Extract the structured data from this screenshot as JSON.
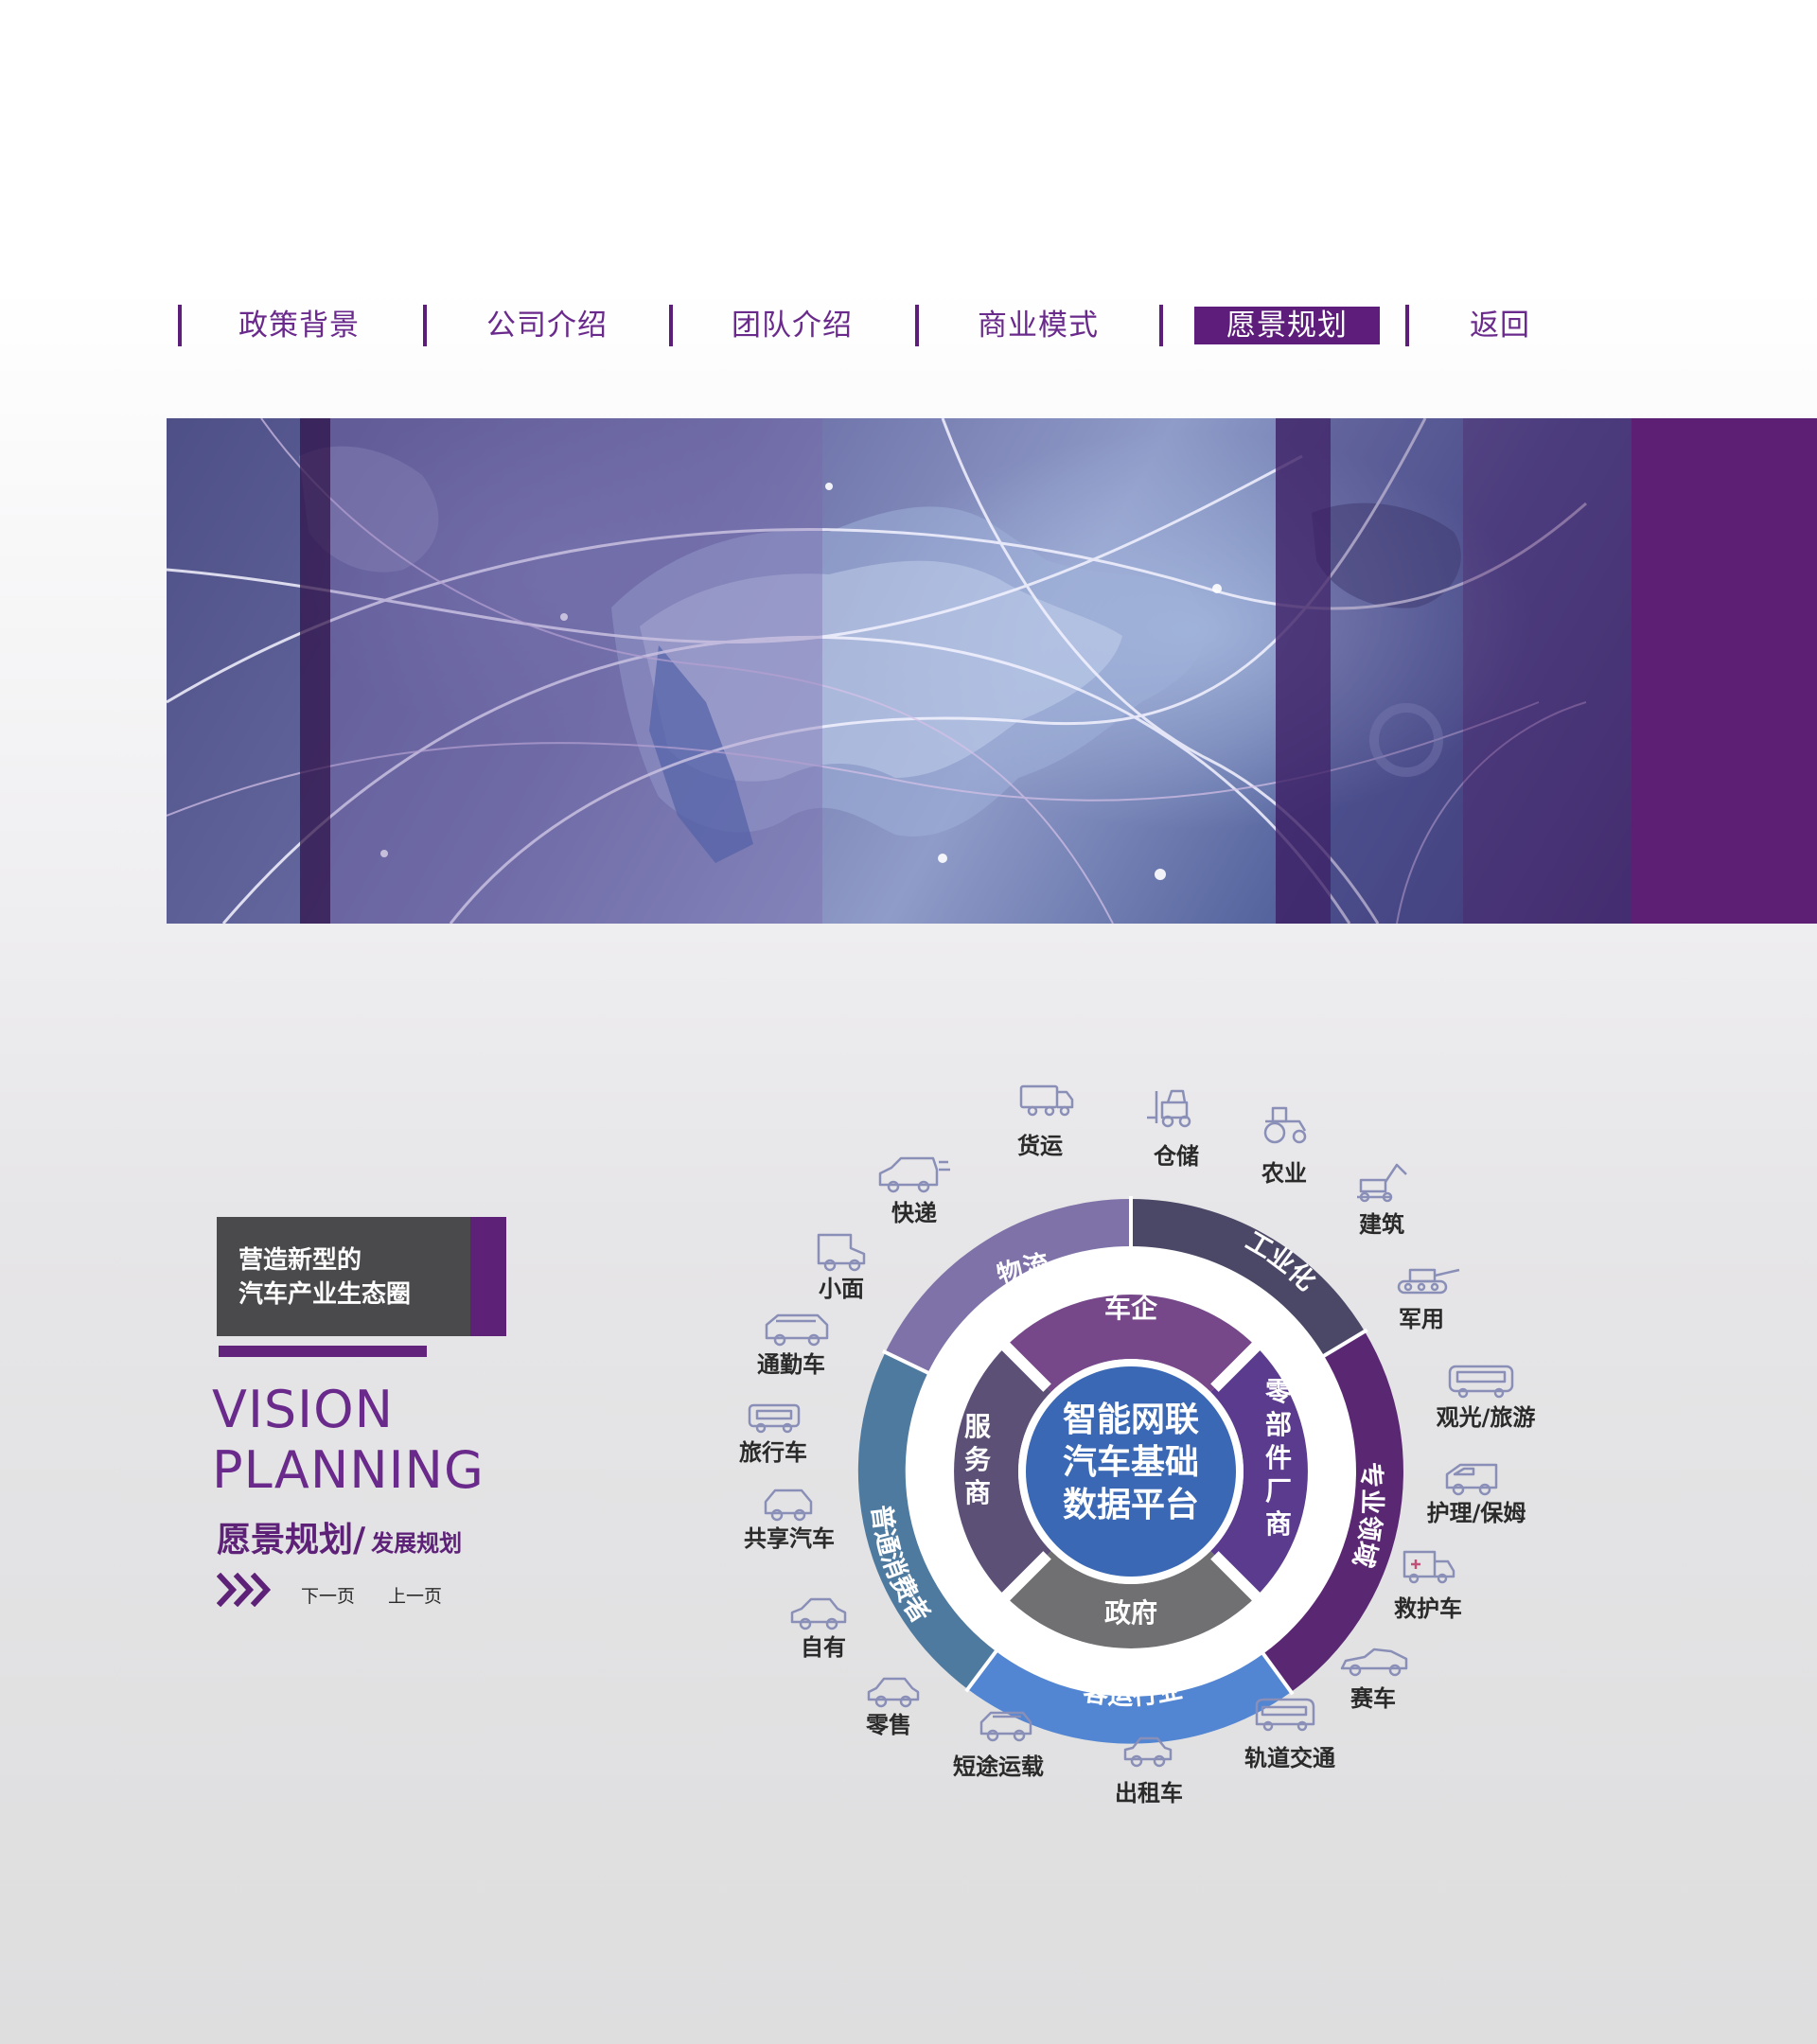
{
  "nav": {
    "items": [
      {
        "label": "政策背景",
        "active": false
      },
      {
        "label": "公司介绍",
        "active": false
      },
      {
        "label": "团队介绍",
        "active": false
      },
      {
        "label": "商业模式",
        "active": false
      },
      {
        "label": "愿景规划",
        "active": true
      },
      {
        "label": "返回",
        "active": false
      }
    ],
    "colors": {
      "accent": "#5e1d7a",
      "text": "#6a2a8c"
    }
  },
  "card": {
    "line1": "营造新型的",
    "line2": "汽车产业生态圈"
  },
  "vision": {
    "title_line1": "VISION",
    "title_line2": "PLANNING",
    "cn_title": "愿景规划/",
    "cn_subtitle": "发展规划"
  },
  "pager": {
    "next_label": "下一页",
    "prev_label": "上一页"
  },
  "ecosystem": {
    "center": [
      "智能网联",
      "汽车基础",
      "数据平台"
    ],
    "inner_ring": {
      "top": "车企",
      "right": [
        "零",
        "部",
        "件",
        "厂",
        "商"
      ],
      "bottom": "政府",
      "left": [
        "服",
        "务",
        "商"
      ]
    },
    "outer_ring": {
      "top_left": "物流",
      "top_right": "工业化",
      "right": "专业领域",
      "bottom": "客运行业",
      "left": "普通消费者"
    },
    "vehicles": [
      {
        "label": "货运",
        "icon": "cargo-truck-icon"
      },
      {
        "label": "仓储",
        "icon": "forklift-icon"
      },
      {
        "label": "农业",
        "icon": "tractor-icon"
      },
      {
        "label": "建筑",
        "icon": "excavator-icon"
      },
      {
        "label": "军用",
        "icon": "tank-icon"
      },
      {
        "label": "观光/旅游",
        "icon": "tour-bus-icon"
      },
      {
        "label": "护理/保姆",
        "icon": "van-icon"
      },
      {
        "label": "救护车",
        "icon": "ambulance-icon"
      },
      {
        "label": "赛车",
        "icon": "race-car-icon"
      },
      {
        "label": "轨道交通",
        "icon": "train-icon"
      },
      {
        "label": "出租车",
        "icon": "taxi-icon"
      },
      {
        "label": "短途运载",
        "icon": "shuttle-car-icon"
      },
      {
        "label": "零售",
        "icon": "compact-car-icon"
      },
      {
        "label": "自有",
        "icon": "sedan-icon"
      },
      {
        "label": "共享汽车",
        "icon": "shared-car-icon"
      },
      {
        "label": "旅行车",
        "icon": "rv-icon"
      },
      {
        "label": "通勤车",
        "icon": "commuter-car-icon"
      },
      {
        "label": "小面",
        "icon": "minivan-icon"
      },
      {
        "label": "快递",
        "icon": "delivery-van-icon"
      }
    ],
    "colors": {
      "center": "#3a68b4",
      "inner_top": "#76488a",
      "inner_right": "#5b3b8e",
      "inner_bottom": "#707072",
      "inner_left": "#5d5077",
      "outer_wuliu": "#7f72a9",
      "outer_industry": "#4a4866",
      "outer_special": "#5a2773",
      "outer_passenger": "#5285d2",
      "outer_consumer": "#4f7aa0"
    }
  }
}
